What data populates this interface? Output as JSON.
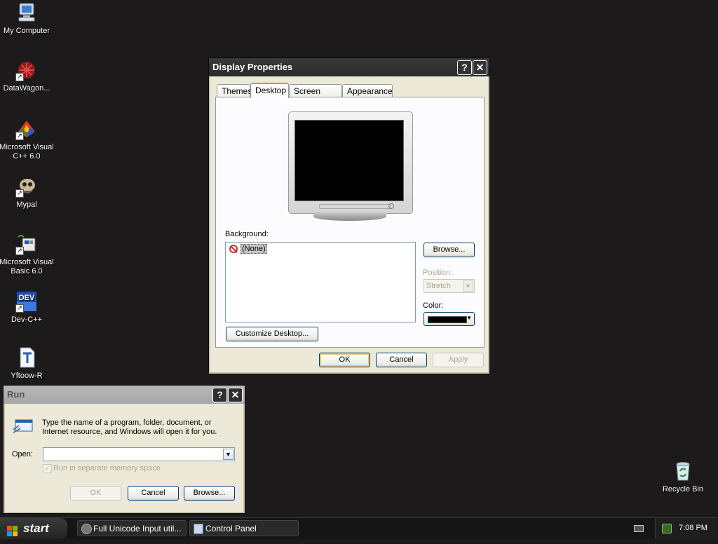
{
  "desktop": {
    "icons": [
      {
        "label": "My Computer"
      },
      {
        "label": "DataWagon..."
      },
      {
        "label": "Microsoft Visual C++ 6.0"
      },
      {
        "label": "Mypal"
      },
      {
        "label": "Microsoft Visual Basic 6.0"
      },
      {
        "label": "Dev-C++"
      },
      {
        "label": "Yftoow-R"
      },
      {
        "label": "Recycle Bin"
      }
    ],
    "dev_icon_text": "DEV"
  },
  "display_properties": {
    "title": "Display Properties",
    "help_glyph": "?",
    "close_glyph": "✕",
    "tabs": [
      {
        "label": "Themes"
      },
      {
        "label": "Desktop"
      },
      {
        "label": "Screen Saver"
      },
      {
        "label": "Appearance"
      }
    ],
    "background_label": "Background:",
    "background_items": [
      "(None)"
    ],
    "browse_label": "Browse...",
    "position_label": "Position:",
    "position_value": "Stretch",
    "color_label": "Color:",
    "color_value": "#000000",
    "customize_label": "Customize Desktop...",
    "ok_label": "OK",
    "cancel_label": "Cancel",
    "apply_label": "Apply"
  },
  "run_dialog": {
    "title": "Run",
    "help_glyph": "?",
    "close_glyph": "✕",
    "description": "Type the name of a program, folder, document, or Internet resource, and Windows will open it for you.",
    "open_label": "Open:",
    "open_value": "",
    "separate_memory_label": "Run in separate memory space",
    "separate_memory_checked": true,
    "ok_label": "OK",
    "cancel_label": "Cancel",
    "browse_label": "Browse..."
  },
  "taskbar": {
    "start_label": "start",
    "tasks": [
      {
        "label": "Full Unicode Input util..."
      },
      {
        "label": "Control Panel"
      }
    ],
    "clock": "7:08 PM"
  }
}
